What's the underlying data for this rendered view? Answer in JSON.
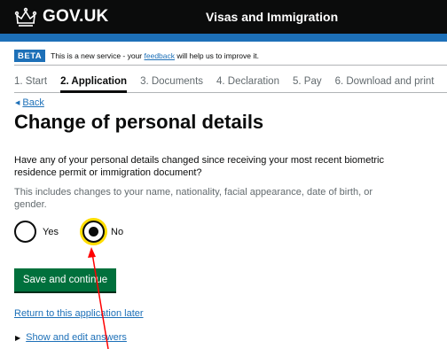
{
  "header": {
    "logo_text": "GOV.UK",
    "logo_icon": "crown-icon",
    "service_name": "Visas and Immigration"
  },
  "beta": {
    "tag": "BETA",
    "text_before": "This is a new service - your ",
    "link": "feedback",
    "text_after": " will help us to improve it."
  },
  "steps": [
    {
      "label": "1. Start",
      "current": false
    },
    {
      "label": "2. Application",
      "current": true
    },
    {
      "label": "3. Documents",
      "current": false
    },
    {
      "label": "4. Declaration",
      "current": false
    },
    {
      "label": "5. Pay",
      "current": false
    },
    {
      "label": "6. Download and print",
      "current": false
    }
  ],
  "back": {
    "label": "Back",
    "icon": "triangle-left-icon"
  },
  "page": {
    "title": "Change of personal details",
    "question": "Have any of your personal details changed since receiving your most recent biometric residence permit or immigration document?",
    "hint": "This includes changes to your name, nationality, facial appearance, date of birth, or gender."
  },
  "options": {
    "yes": {
      "label": "Yes",
      "selected": false
    },
    "no": {
      "label": "No",
      "selected": true
    }
  },
  "actions": {
    "save_label": "Save and continue",
    "return_label": "Return to this application later",
    "details_label": "Show and edit answers",
    "details_icon": "triangle-right-icon"
  },
  "colors": {
    "header": "#0b0c0c",
    "brand_blue": "#1d70b8",
    "button_green": "#00703c",
    "focus_yellow": "#ffdd00",
    "annotation_arrow": "#ff0000"
  }
}
